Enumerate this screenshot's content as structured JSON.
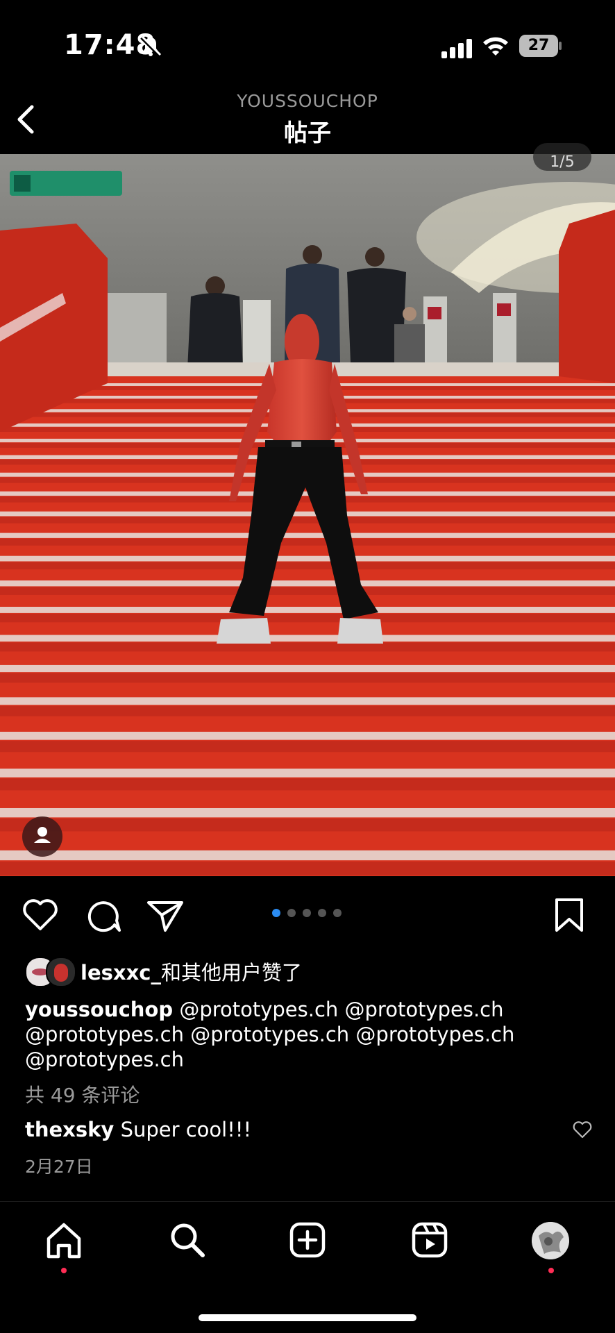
{
  "status_bar": {
    "time": "17:48",
    "battery": "27",
    "icons": [
      "bell-slash-icon",
      "cellular-signal-icon",
      "wifi-icon",
      "battery-icon"
    ]
  },
  "header": {
    "username": "YOUSSOUCHOP",
    "title": "帖子",
    "back_icon": "chevron-left-icon"
  },
  "post": {
    "page_counter": "1/5",
    "carousel": {
      "count": 5,
      "active_index": 0
    },
    "actions": [
      "heart-icon",
      "comment-icon",
      "send-icon",
      "bookmark-icon"
    ],
    "likes": {
      "user": "lesxxc_",
      "suffix": "和其他用户赞了"
    },
    "caption": {
      "user": "youssouchop",
      "text": "@prototypes.ch @prototypes.ch @prototypes.ch @prototypes.ch @prototypes.ch @prototypes.ch"
    },
    "comments_count": "共 49 条评论",
    "top_comment": {
      "user": "thexsky",
      "text": "Super cool!!!"
    },
    "date": "2月27日"
  },
  "nav": {
    "items": [
      "home-icon",
      "search-icon",
      "create-icon",
      "reels-icon",
      "profile-avatar"
    ],
    "accent": "#ff2d55"
  },
  "colors": {
    "background": "#000000",
    "secondary_text": "#9a9a9a",
    "carousel_active": "#2b8cf2",
    "stairs_red": "#d8331f"
  }
}
